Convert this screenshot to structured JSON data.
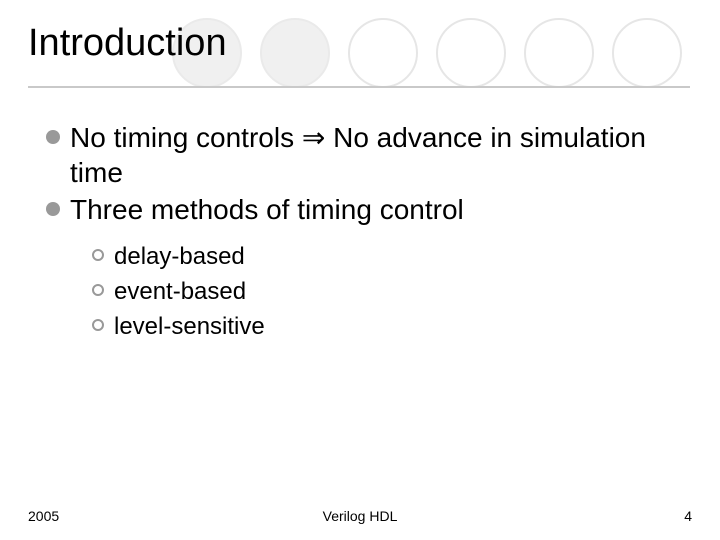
{
  "title": "Introduction",
  "bullets": [
    {
      "text": "No timing controls ⇒ No advance in simulation time"
    },
    {
      "text": "Three methods of timing control"
    }
  ],
  "subbullets": [
    {
      "text": "delay-based"
    },
    {
      "text": "event-based"
    },
    {
      "text": "level-sensitive"
    }
  ],
  "footer": {
    "left": "2005",
    "center": "Verilog HDL",
    "right": "4"
  },
  "decor": {
    "circle_colors": {
      "empty_border": "#e6e6e6",
      "filled_bg": "#f0f0f0"
    }
  }
}
